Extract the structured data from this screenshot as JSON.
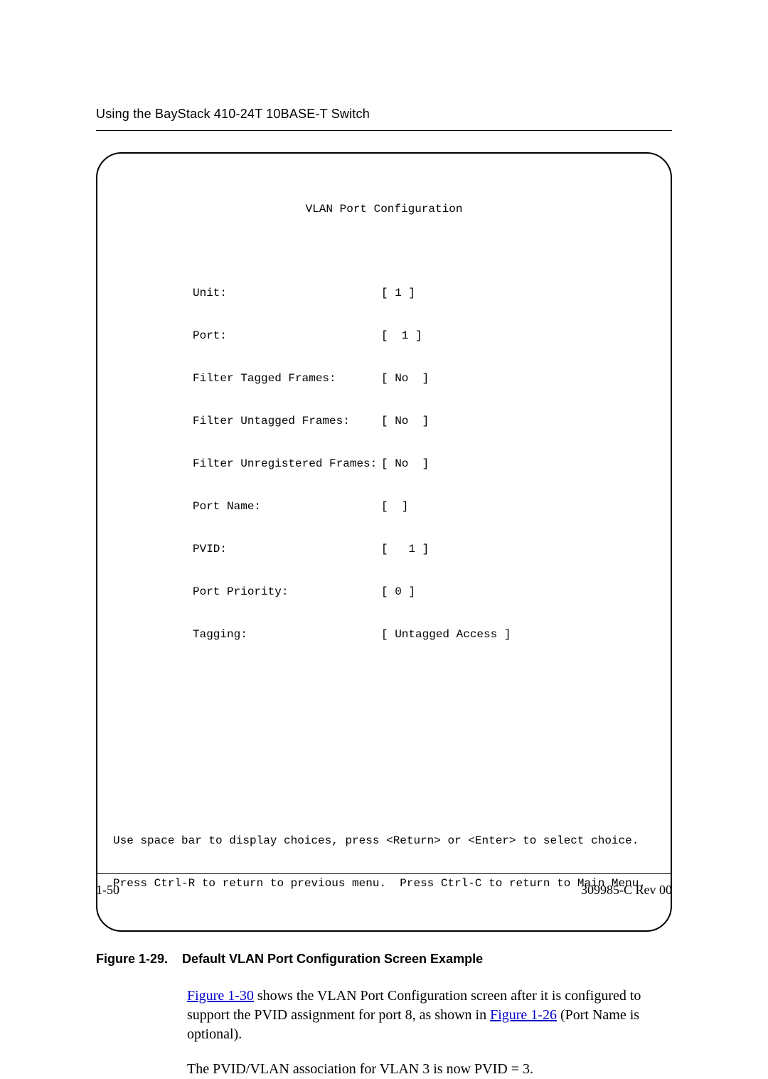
{
  "header": {
    "running_head": "Using the BayStack 410-24T 10BASE-T Switch"
  },
  "terminal": {
    "title": "VLAN Port Configuration",
    "fields": [
      {
        "label": "Unit:",
        "value": "[ 1 ]"
      },
      {
        "label": "Port:",
        "value": "[  1 ]"
      },
      {
        "label": "Filter Tagged Frames:",
        "value": "[ No  ]"
      },
      {
        "label": "Filter Untagged Frames:",
        "value": "[ No  ]"
      },
      {
        "label": "Filter Unregistered Frames:",
        "value": "[ No  ]"
      },
      {
        "label": "Port Name:",
        "value": "[  ]"
      },
      {
        "label": "PVID:",
        "value": "[   1 ]"
      },
      {
        "label": "Port Priority:",
        "value": "[ 0 ]"
      },
      {
        "label": "Tagging:",
        "value": "[ Untagged Access ]"
      }
    ],
    "help1": "Use space bar to display choices, press <Return> or <Enter> to select choice.",
    "help2": "Press Ctrl-R to return to previous menu.  Press Ctrl-C to return to Main Menu."
  },
  "caption": {
    "fig_label": "Figure 1-29.",
    "text": "Default VLAN Port Configuration Screen Example"
  },
  "body": {
    "p1_link1": "Figure 1-30",
    "p1_mid": " shows the VLAN Port Configuration screen after it is configured to support the PVID assignment for port 8, as shown in ",
    "p1_link2": "Figure 1-26",
    "p1_tail": " (Port Name is optional).",
    "p2": "The PVID/VLAN association for VLAN 3 is now PVID = 3."
  },
  "footer": {
    "page_num": "1-50",
    "doc_id": "309985-C Rev 00"
  }
}
